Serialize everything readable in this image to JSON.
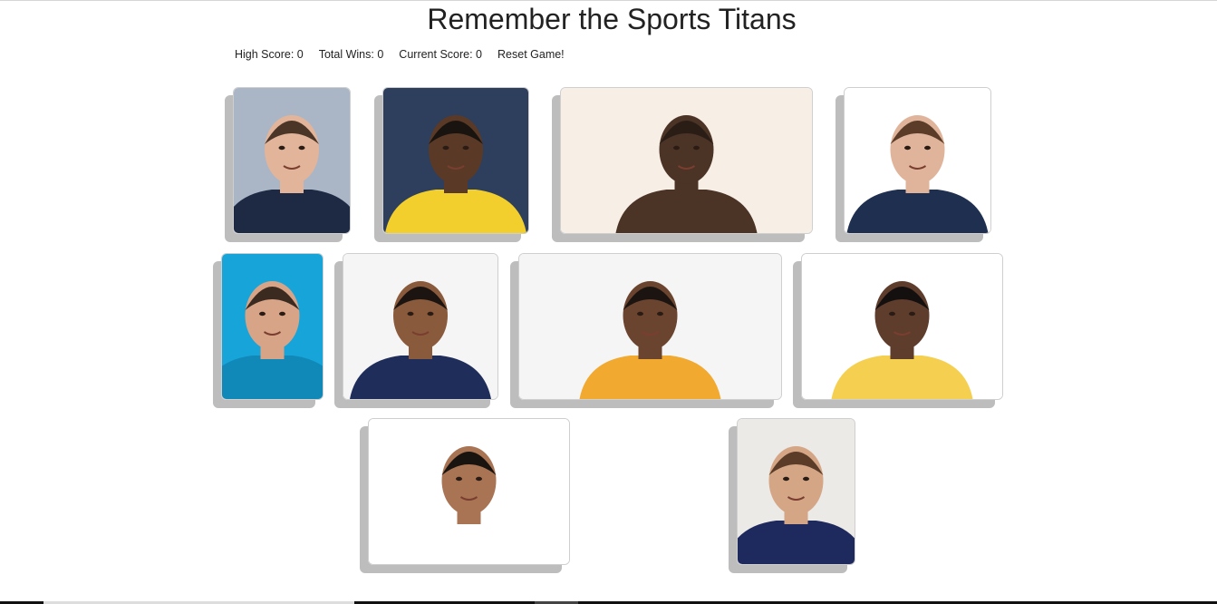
{
  "title": "Remember the Sports Titans",
  "scoreboard": {
    "high_score": "High Score: 0",
    "total_wins": "Total Wins: 0",
    "current_score": "Current Score: 0",
    "reset_label": "Reset Game!"
  },
  "cards": [
    {
      "id": "tom-brady",
      "bg": "#aab6c6",
      "skin": "#e2b49a",
      "hair": "#4a3526",
      "shirt": "#1e2a44"
    },
    {
      "id": "usain-bolt",
      "bg": "#2d3f5c",
      "skin": "#5a3a26",
      "hair": "#1a1410",
      "shirt": "#f2cf2c"
    },
    {
      "id": "floyd-mayweather",
      "bg": "#f7eee6",
      "skin": "#4b3326",
      "hair": "#2a1d16",
      "shirt": "#4b3326"
    },
    {
      "id": "roger-federer",
      "bg": "#ffffff",
      "skin": "#e0b49a",
      "hair": "#5a3c28",
      "shirt": "#1f2f4f"
    },
    {
      "id": "michael-phelps",
      "bg": "#17a4d8",
      "skin": "#d8a488",
      "hair": "#3a2a20",
      "shirt": "#1189b8"
    },
    {
      "id": "tiger-woods",
      "bg": "#f5f5f5",
      "skin": "#8a5a3c",
      "hair": "#1c1410",
      "shirt": "#1f2d5a"
    },
    {
      "id": "kobe-bryant",
      "bg": "#f5f5f5",
      "skin": "#6b4430",
      "hair": "#1c1410",
      "shirt": "#f2a930"
    },
    {
      "id": "lebron-james",
      "bg": "#ffffff",
      "skin": "#5e3d2c",
      "hair": "#151010",
      "shirt": "#f5d050"
    },
    {
      "id": "stephen-curry",
      "bg": "#ffffff",
      "skin": "#a87454",
      "hair": "#1a1410",
      "shirt": "#ffffff"
    },
    {
      "id": "lionel-messi",
      "bg": "#eceae6",
      "skin": "#d4a686",
      "hair": "#5a3c28",
      "shirt": "#1e2a5e"
    }
  ]
}
